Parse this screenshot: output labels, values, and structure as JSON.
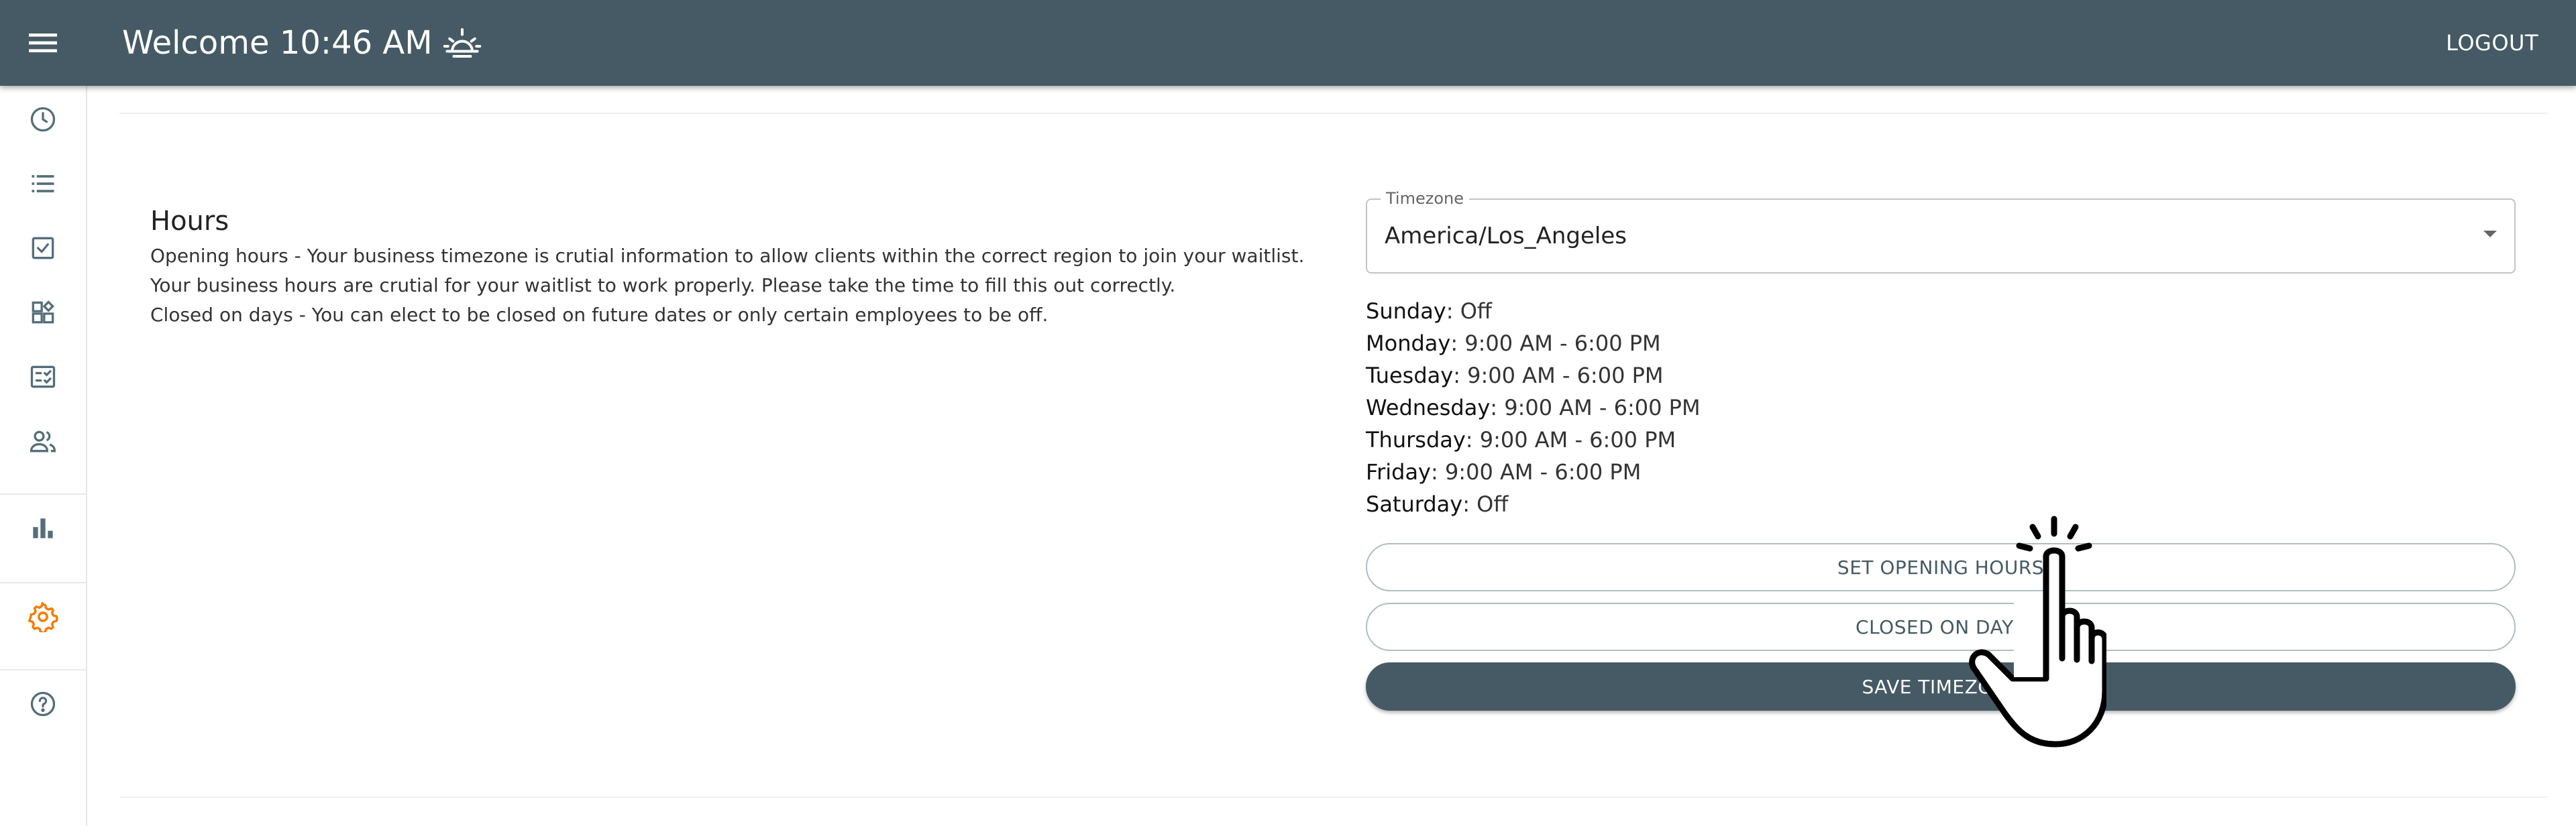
{
  "header": {
    "title": "Welcome 10:46 AM",
    "title_icon": "sunrise-icon",
    "logout_label": "LOGOUT",
    "background": "#455a64"
  },
  "sidebar": {
    "items": [
      {
        "icon": "clock-icon"
      },
      {
        "icon": "list-icon"
      },
      {
        "icon": "checkbox-icon"
      },
      {
        "icon": "widgets-icon"
      },
      {
        "icon": "checklist-icon"
      },
      {
        "icon": "people-icon"
      },
      {
        "icon": "bar-chart-icon"
      },
      {
        "icon": "gear-icon",
        "active": true
      },
      {
        "icon": "help-icon"
      }
    ],
    "active_color": "#f57c00"
  },
  "hours": {
    "title": "Hours",
    "description": [
      "Opening hours - Your business timezone is crutial information to allow clients within the correct region to join your waitlist.",
      "Your business hours are crutial for your waitlist to work properly. Please take the time to fill this out correctly.",
      "Closed on days - You can elect to be closed on future dates or only certain employees to be off."
    ]
  },
  "timezone": {
    "label": "Timezone",
    "value": "America/Los_Angeles"
  },
  "schedule": [
    {
      "day": "Sunday",
      "hours": ": Off"
    },
    {
      "day": "Monday",
      "hours": ": 9:00 AM - 6:00 PM"
    },
    {
      "day": "Tuesday",
      "hours": ": 9:00 AM - 6:00 PM"
    },
    {
      "day": "Wednesday",
      "hours": ": 9:00 AM - 6:00 PM"
    },
    {
      "day": "Thursday",
      "hours": ": 9:00 AM - 6:00 PM"
    },
    {
      "day": "Friday",
      "hours": ": 9:00 AM - 6:00 PM"
    },
    {
      "day": "Saturday",
      "hours": ": Off"
    }
  ],
  "buttons": {
    "set_opening_hours": "SET OPENING HOURS",
    "closed_on_days": "CLOSED ON DAYS",
    "save_timezone": "SAVE TIMEZONE"
  }
}
